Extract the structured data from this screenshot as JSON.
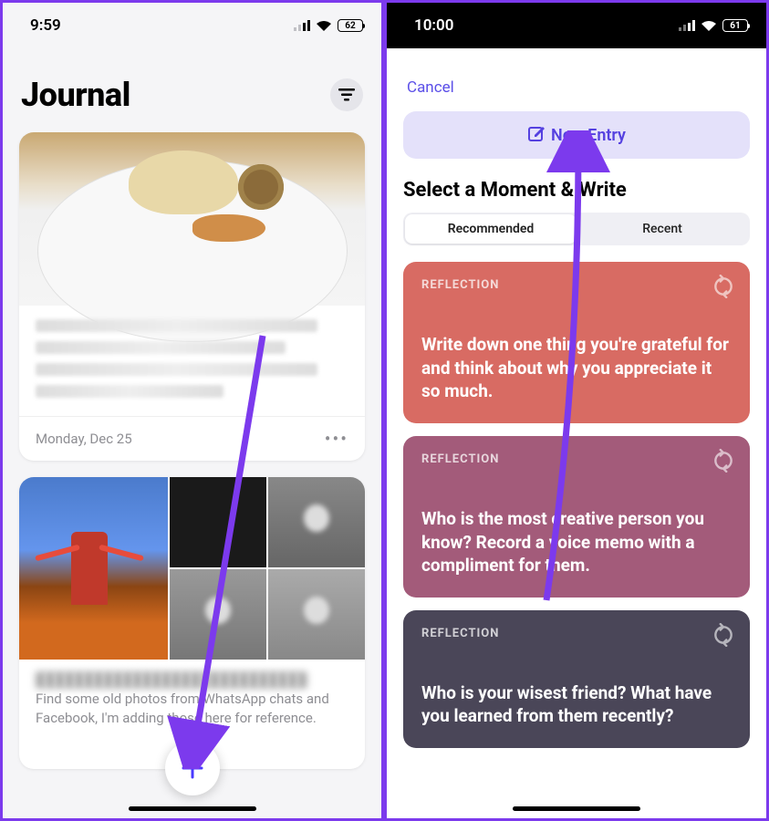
{
  "left": {
    "statusTime": "9:59",
    "battery": "62",
    "appTitle": "Journal",
    "card1": {
      "date": "Monday, Dec 25"
    },
    "card2": {
      "caption": "Find some old photos from WhatsApp chats and Facebook, I'm adding those here for reference."
    }
  },
  "right": {
    "statusTime": "10:00",
    "battery": "61",
    "cancel": "Cancel",
    "newEntry": "New Entry",
    "selectTitle": "Select a Moment & Write",
    "segRecommended": "Recommended",
    "segRecent": "Recent",
    "cards": [
      {
        "tag": "REFLECTION",
        "text": "Write down one thing you're grateful for and think about why you appreciate it so much."
      },
      {
        "tag": "REFLECTION",
        "text": "Who is the most creative person you know? Record a voice memo with a compliment for them."
      },
      {
        "tag": "REFLECTION",
        "text": "Who is your wisest friend? What have you learned from them recently?"
      }
    ]
  }
}
